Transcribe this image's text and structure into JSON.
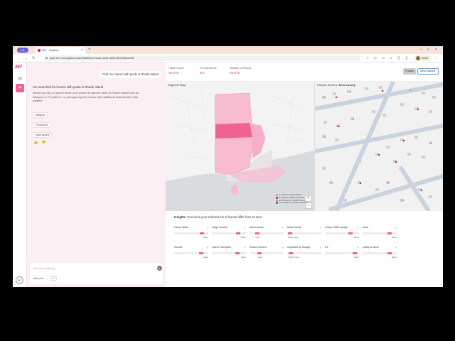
{
  "browser": {
    "profile_label": "LA",
    "tab_title": "257 · Explore",
    "url": "pilot.257.co/explore/chat/344896c2-3deb-4290-a93f-35f72b4bc018",
    "work_label": "Work"
  },
  "rail": {
    "logo": "257",
    "avatar": "SC"
  },
  "chat": {
    "user_message": "Find me homes with pools in Rhode Island",
    "ai_title": "I've searched for homes with pools in Rhode Island",
    "ai_body": "Would you like to narrow down your search to specific cities in Rhode Island such as Newport or Providence, or perhaps explore homes with additional features like solar panels?",
    "suggestions": [
      "Newport",
      "Providence",
      "solar panels"
    ],
    "composer_placeholder": "Ask me anything...",
    "composer_chip": "with pool",
    "composer_chip2": "x  ^"
  },
  "stats": {
    "home_count_label": "Home Count",
    "home_count": "36,578",
    "universe_label": "% of Universe",
    "universe": "5%",
    "people_label": "Number of People",
    "people": "62,679",
    "publish_label": "Publish",
    "new_explore_label": "New Explore"
  },
  "segment_map": {
    "title": "Segment Map",
    "legend": [
      {
        "label": "In Segment, Single Property",
        "color": "#f48fb1"
      },
      {
        "label": "In Segment, Multiple Properties",
        "color": "#c2185b"
      },
      {
        "label": "Out of Segment, Single Property",
        "color": "#9e9e9e"
      },
      {
        "label": "Out of Segment, Multiple Properties",
        "color": "#616161"
      }
    ]
  },
  "street_map": {
    "title_prefix": "Sample Street in",
    "county": "Kent county"
  },
  "insights": {
    "title": "Insights",
    "subtitle": "How does your selected set of homes differ from its area",
    "items": [
      {
        "label": "Home Value",
        "fill": 0.82,
        "dir": "More"
      },
      {
        "label": "Large Homes",
        "fill": 0.78,
        "dir": "More"
      },
      {
        "label": "New Homes",
        "fill": 0.22,
        "dir": "Less"
      },
      {
        "label": "Multi-Family",
        "fill": 0.08,
        "dir": "Much Less"
      },
      {
        "label": "Yearly HVAC Usage",
        "fill": 0.76,
        "dir": "More"
      },
      {
        "label": "Solar",
        "fill": 0.8,
        "dir": "More"
      },
      {
        "label": "Income",
        "fill": 0.8,
        "dir": "More"
      },
      {
        "label": "Owner Occupied",
        "fill": 0.74,
        "dir": "More"
      },
      {
        "label": "Recent Movers",
        "fill": 0.3,
        "dir": "Less"
      },
      {
        "label": "Impacted by Outage",
        "fill": 0.1,
        "dir": "Much Less"
      },
      {
        "label": "EV",
        "fill": 0.88,
        "dir": "More"
      },
      {
        "label": "Likely to Move",
        "fill": 0.8,
        "dir": "More"
      }
    ]
  }
}
